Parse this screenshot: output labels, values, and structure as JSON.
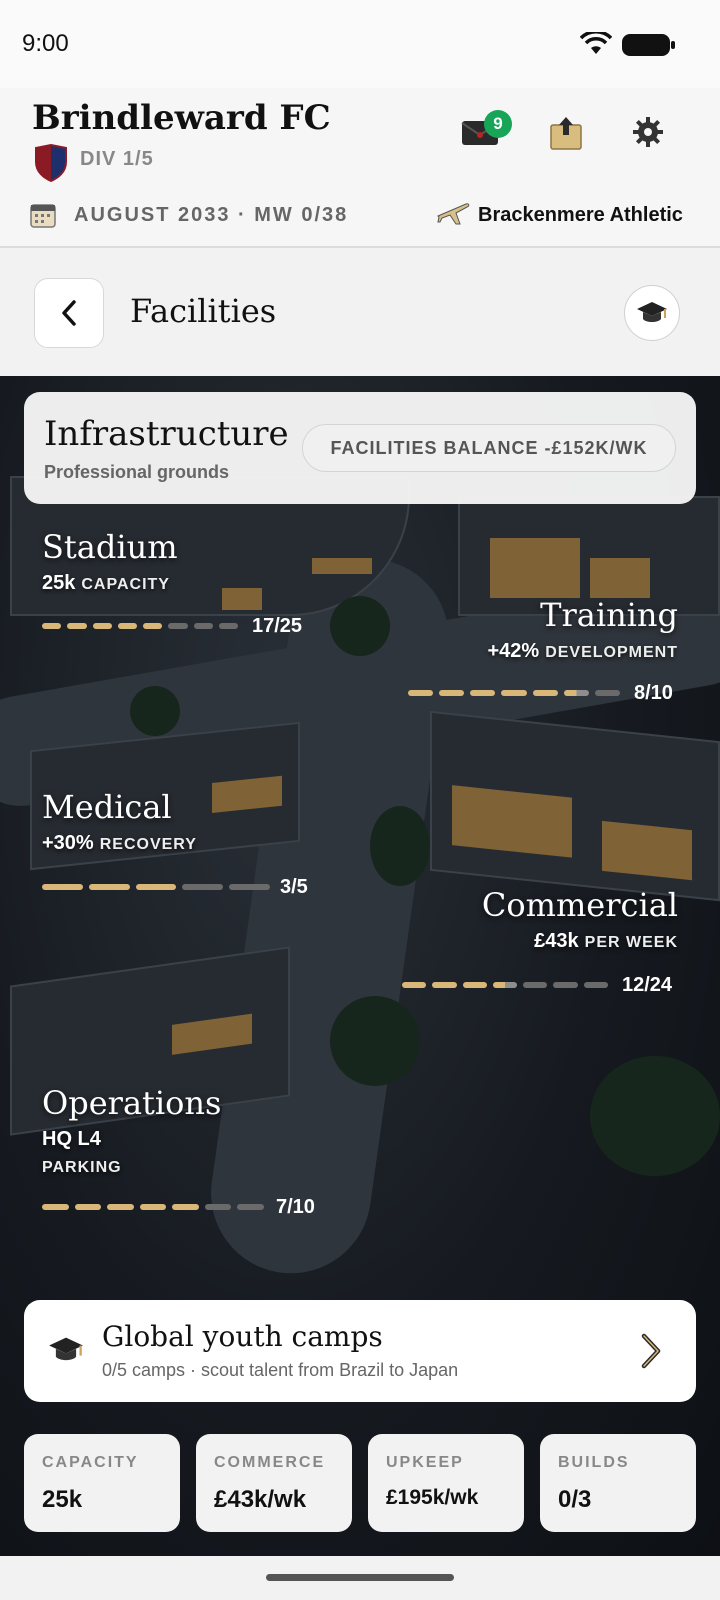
{
  "status_bar": {
    "time": "9:00"
  },
  "header": {
    "club_name": "Brindleward FC",
    "division": "DIV 1/5",
    "mail_badge_count": "9",
    "date_line": "AUGUST 2033 · MW 0/38",
    "next_opponent": "Brackenmere Athletic"
  },
  "title_bar": {
    "title": "Facilities"
  },
  "infrastructure": {
    "title": "Infrastructure",
    "subtitle": "Professional grounds",
    "balance": "FACILITIES BALANCE -£152K/WK"
  },
  "facilities": {
    "stadium": {
      "name": "Stadium",
      "value": "25k",
      "unit": "CAPACITY",
      "level": "17/25",
      "level_fraction": 0.68
    },
    "training": {
      "name": "Training",
      "value": "+42%",
      "unit": "DEVELOPMENT",
      "level": "8/10",
      "level_fraction": 0.8
    },
    "medical": {
      "name": "Medical",
      "value": "+30%",
      "unit": "RECOVERY",
      "level": "3/5",
      "level_fraction": 0.6
    },
    "commercial": {
      "name": "Commercial",
      "value": "£43k",
      "unit": "PER WEEK",
      "level": "12/24",
      "level_fraction": 0.5
    },
    "operations": {
      "name": "Operations",
      "value": "HQ L4",
      "unit": "PARKING",
      "level": "7/10",
      "level_fraction": 0.7
    }
  },
  "youth_camps": {
    "title": "Global youth camps",
    "subtitle": "0/5 camps · scout talent from Brazil to Japan"
  },
  "summary": {
    "capacity": {
      "label": "CAPACITY",
      "value": "25k"
    },
    "commerce": {
      "label": "COMMERCE",
      "value": "£43k/wk"
    },
    "upkeep": {
      "label": "UPKEEP",
      "value": "£195k/wk"
    },
    "builds": {
      "label": "BUILDS",
      "value": "0/3"
    }
  },
  "colors": {
    "accent_gold": "#d9b779",
    "badge_green": "#18a558"
  },
  "icons": [
    "wifi-icon",
    "battery-icon",
    "club-crest-icon",
    "mail-icon",
    "upload-box-icon",
    "gear-icon",
    "calendar-icon",
    "airplane-icon",
    "chevron-left-icon",
    "graduation-cap-icon",
    "chevron-right-icon"
  ]
}
